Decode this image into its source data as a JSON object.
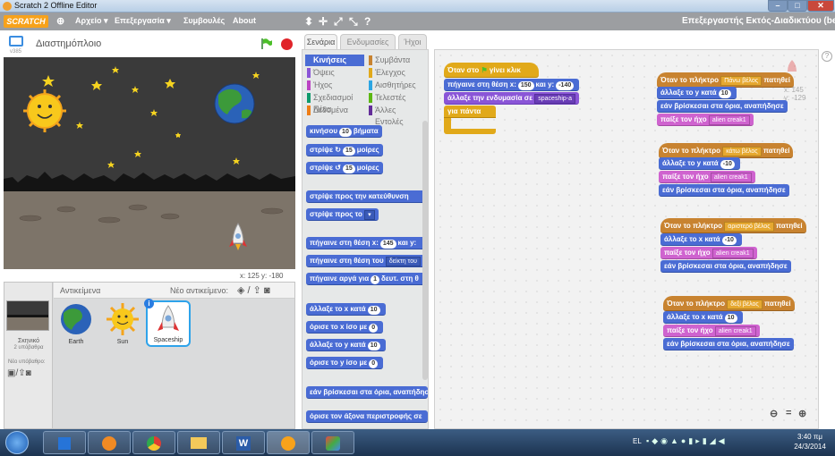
{
  "window": {
    "title": "Scratch 2 Offline Editor",
    "min": "–",
    "max": "□",
    "close": "✕"
  },
  "menu": {
    "logo": "SCRATCH",
    "items": [
      "Αρχείο ▾",
      "Επεξεργασία ▾",
      "Συμβουλές",
      "About"
    ],
    "right_text": "Επεξεργαστής Εκτός-Διαδικτύου (beta)"
  },
  "stage": {
    "version_label": "v385",
    "project_title": "Διαστημόπλοιο",
    "coords": "x: 125  y: -180"
  },
  "sprites": {
    "header": "Αντικείμενα",
    "new_sprite_label": "Νέο αντικείμενο:",
    "stage_label": "Σκηνικό",
    "stage_sub": "2 υπόβαθρα",
    "new_backdrop_label": "Νέο υπόβαθρο:",
    "items": [
      {
        "name": "Earth"
      },
      {
        "name": "Sun"
      },
      {
        "name": "Spaceship"
      }
    ]
  },
  "tabs": [
    "Σενάρια",
    "Ενδυμασίες",
    "Ήχοι"
  ],
  "categories_left": [
    {
      "label": "Κινήσεις",
      "color": "#4a6cd4",
      "selected": true
    },
    {
      "label": "Όψεις",
      "color": "#8a55d7"
    },
    {
      "label": "Ήχος",
      "color": "#bb42c3"
    },
    {
      "label": "Σχεδιασμοί Πένα",
      "color": "#0e9a6c"
    },
    {
      "label": "Δεδομένα",
      "color": "#ee7d16"
    }
  ],
  "categories_right": [
    {
      "label": "Συμβάντα",
      "color": "#c88330"
    },
    {
      "label": "Έλεγχος",
      "color": "#e1a91a"
    },
    {
      "label": "Αισθητήρες",
      "color": "#2ca5e2"
    },
    {
      "label": "Τελεστές",
      "color": "#5cb712"
    },
    {
      "label": "Άλλες Εντολές",
      "color": "#632d99"
    }
  ],
  "palette_blocks": [
    {
      "pre": "κινήσου",
      "num": "10",
      "post": "βήματα"
    },
    {
      "pre": "στρίψε ↻",
      "num": "15",
      "post": "μοίρες"
    },
    {
      "pre": "στρίψε ↺",
      "num": "15",
      "post": "μοίρες"
    },
    {
      "pre": "στρίψε προς την κατεύθυνση",
      "num": "90",
      "post": ""
    },
    {
      "pre": "στρίψε προς το",
      "num": "",
      "post": "▾"
    },
    {
      "pre": "πήγαινε στη θέση x:",
      "num": "145",
      "post": "και y:"
    },
    {
      "pre": "πήγαινε στη θέση του",
      "num": "δείκτη του",
      "post": ""
    },
    {
      "pre": "πήγαινε αργά για",
      "num": "1",
      "post": "δευτ. στη θ"
    },
    {
      "pre": "άλλαξε το x κατά",
      "num": "10",
      "post": ""
    },
    {
      "pre": "όρισε το x ίσο με",
      "num": "0",
      "post": ""
    },
    {
      "pre": "άλλαξε το y κατά",
      "num": "10",
      "post": ""
    },
    {
      "pre": "όρισε το y ίσο με",
      "num": "0",
      "post": ""
    },
    {
      "pre": "εάν βρίσκεσαι στα όρια, αναπήδησε",
      "num": "",
      "post": ""
    },
    {
      "pre": "όρισε τον άξονα περιστροφής σε",
      "num": "",
      "post": ""
    }
  ],
  "script_main": {
    "hat": "Όταν στο",
    "hat_post": "γίνει κλικ",
    "goto_pre": "πήγαινε στη θέση x:",
    "goto_x": "150",
    "goto_mid": "και y:",
    "goto_y": "-140",
    "costume_pre": "άλλαξε την ενδυμασία σε",
    "costume_val": "spaceship-a",
    "forever": "για πάντα"
  },
  "key_scripts": [
    {
      "hat_pre": "Όταν το πλήκτρο",
      "key": "Πάνω βέλος",
      "hat_post": "πατηθεί",
      "l1": "άλλαξε το y κατά",
      "l1n": "10",
      "l2": "εάν βρίσκεσαι στα όρια, αναπήδησε",
      "l3": "παίξε τον ήχο",
      "l3v": "alien creak1"
    },
    {
      "hat_pre": "Όταν το πλήκτρο",
      "key": "κάτω βέλος",
      "hat_post": "πατηθεί",
      "l1": "άλλαξε το y κατά",
      "l1n": "-10",
      "l2": "παίξε τον ήχο",
      "l2v": "alien creak1",
      "l3": "εάν βρίσκεσαι στα όρια, αναπήδησε"
    },
    {
      "hat_pre": "Όταν το πλήκτρο",
      "key": "αριστερό βέλος",
      "hat_post": "πατηθεί",
      "l1": "άλλαξε το x κατά",
      "l1n": "-10",
      "l2": "παίξε τον ήχο",
      "l2v": "alien creak1",
      "l3": "εάν βρίσκεσαι στα όρια, αναπήδησε"
    },
    {
      "hat_pre": "Όταν το πλήκτρο",
      "key": "δεξί βέλος",
      "hat_post": "πατηθεί",
      "l1": "άλλαξε το x κατά",
      "l1n": "10",
      "l2": "παίξε τον ήχο",
      "l2v": "alien creak1",
      "l3": "εάν βρίσκεσαι στα όρια, αναπήδησε"
    }
  ],
  "sprite_info": {
    "x": "x: 145",
    "y": "y: -129"
  },
  "zoom": {
    "out": "🔍−",
    "reset": "=",
    "in": "🔍+"
  },
  "taskbar": {
    "lang": "EL",
    "time": "3:40 πμ",
    "date": "24/3/2014"
  }
}
